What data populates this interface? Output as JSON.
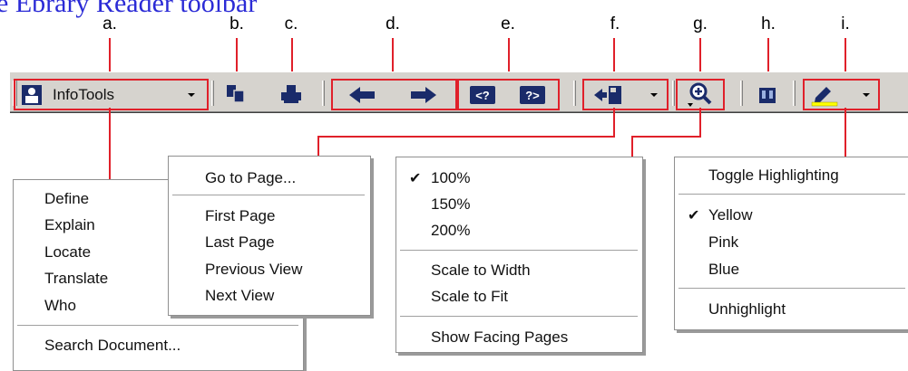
{
  "title": "e Ebrary Reader toolbar",
  "callouts": [
    "a.",
    "b.",
    "c.",
    "d.",
    "e.",
    "f.",
    "g.",
    "h.",
    "i."
  ],
  "toolbar": {
    "infotools_label": "InfoTools",
    "icons": [
      "infotools-icon",
      "copy-icon",
      "print-icon",
      "back-arrow-icon",
      "forward-arrow-icon",
      "prev-search-icon",
      "next-search-icon",
      "go-to-page-icon",
      "zoom-icon",
      "bookshelf-icon",
      "highlight-icon"
    ],
    "colors": {
      "bar": "#d6d3ce",
      "callout": "#e0202a",
      "highlight": "#ffff00"
    }
  },
  "menus": {
    "infotools": {
      "items": [
        "Define",
        "Explain",
        "Locate",
        "Translate",
        "Who"
      ],
      "search": "Search Document..."
    },
    "navigation": {
      "goto": "Go to Page...",
      "items": [
        "First Page",
        "Last Page",
        "Previous View",
        "Next View"
      ]
    },
    "zoom": {
      "levels": [
        "100%",
        "150%",
        "200%"
      ],
      "checked": "100%",
      "scale": [
        "Scale to Width",
        "Scale to Fit"
      ],
      "facing": "Show Facing Pages"
    },
    "highlight": {
      "toggle": "Toggle Highlighting",
      "colors": [
        "Yellow",
        "Pink",
        "Blue"
      ],
      "checked": "Yellow",
      "unhighlight": "Unhighlight"
    }
  }
}
